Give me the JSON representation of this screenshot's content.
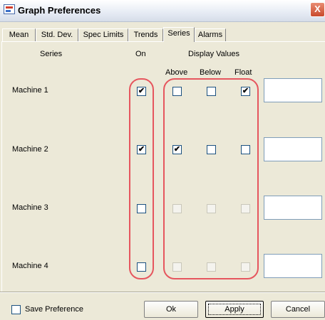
{
  "window": {
    "title": "Graph Preferences",
    "close_glyph": "X"
  },
  "tabs": [
    {
      "label": "Mean",
      "active": false
    },
    {
      "label": "Std. Dev.",
      "active": false
    },
    {
      "label": "Spec Limits",
      "active": false
    },
    {
      "label": "Trends",
      "active": false
    },
    {
      "label": "Series",
      "active": true
    },
    {
      "label": "Alarms",
      "active": false
    }
  ],
  "headers": {
    "series": "Series",
    "on": "On",
    "display_values": "Display Values",
    "above": "Above",
    "below": "Below",
    "float": "Float"
  },
  "rows": [
    {
      "name": "Machine 1",
      "on": true,
      "above": false,
      "below": false,
      "float": true,
      "value": "",
      "enabled": true
    },
    {
      "name": "Machine 2",
      "on": true,
      "above": true,
      "below": false,
      "float": false,
      "value": "",
      "enabled": true
    },
    {
      "name": "Machine 3",
      "on": false,
      "above": false,
      "below": false,
      "float": false,
      "value": "",
      "enabled": false
    },
    {
      "name": "Machine 4",
      "on": false,
      "above": false,
      "below": false,
      "float": false,
      "value": "",
      "enabled": false
    }
  ],
  "check_glyph": "✔",
  "footer": {
    "save_preference_label": "Save Preference",
    "save_preference_checked": false,
    "ok_label": "Ok",
    "apply_label": "Apply",
    "cancel_label": "Cancel"
  },
  "colors": {
    "highlight": "#e6565e"
  }
}
